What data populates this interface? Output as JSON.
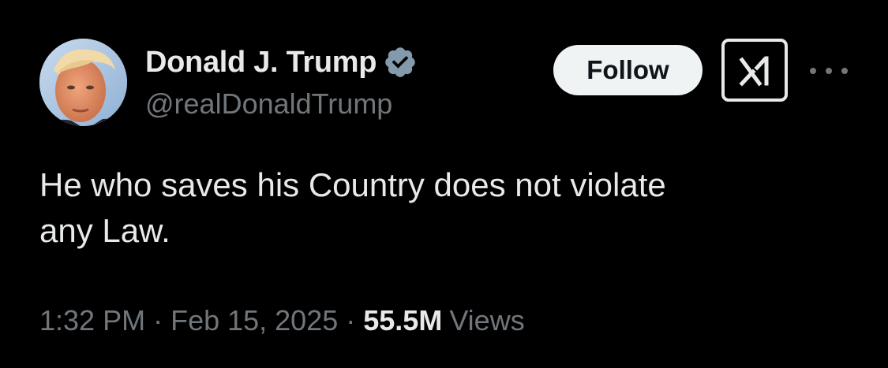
{
  "author": {
    "display_name": "Donald J. Trump",
    "handle": "@realDonaldTrump",
    "verified": true,
    "verified_color": "#829aab",
    "avatar_icon": "profile-photo"
  },
  "actions": {
    "follow_label": "Follow",
    "grok_icon": "grok-icon",
    "more_icon": "more-options-icon"
  },
  "tweet": {
    "text": "He who saves his Country does not violate\nany Law."
  },
  "meta": {
    "time": "1:32 PM",
    "separator": "·",
    "date": "Feb 15, 2025",
    "views_count": "55.5M",
    "views_label": "Views"
  },
  "colors": {
    "background": "#000000",
    "primary_text": "#e7e9ea",
    "secondary_text": "#71767b",
    "follow_button_bg": "#eff3f4"
  }
}
